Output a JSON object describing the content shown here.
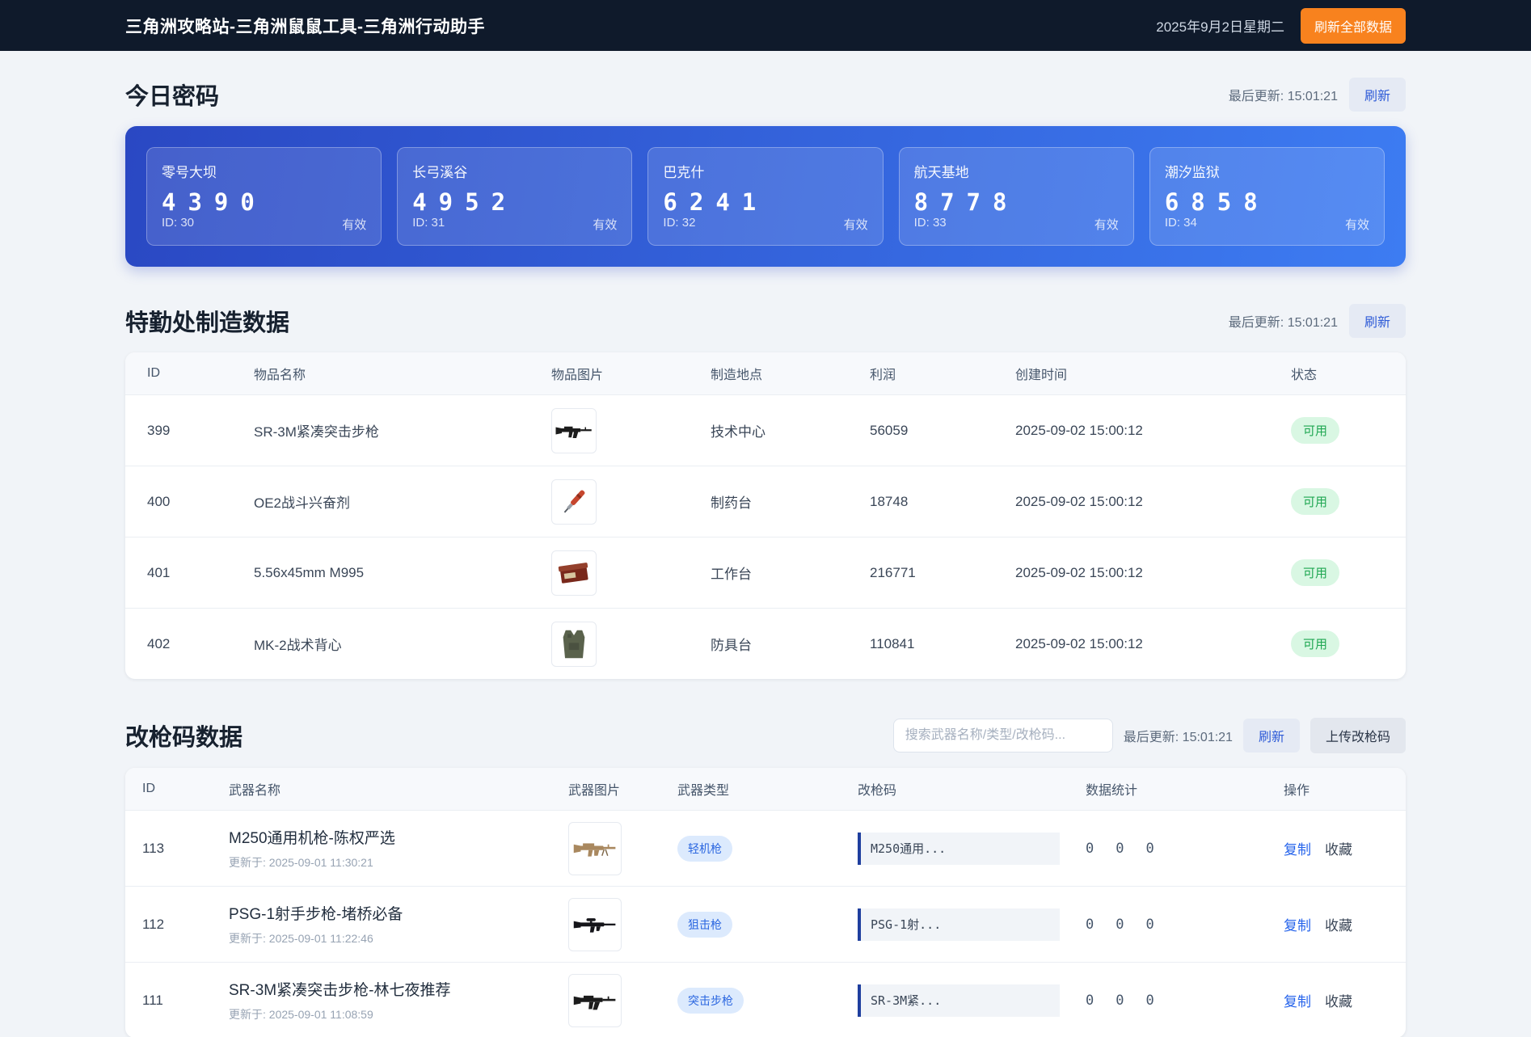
{
  "header": {
    "title": "三角洲攻略站-三角洲鼠鼠工具-三角洲行动助手",
    "date": "2025年9月2日星期二",
    "refresh_all_label": "刷新全部数据"
  },
  "passwords": {
    "title": "今日密码",
    "last_update": "最后更新: 15:01:21",
    "refresh_label": "刷新",
    "cards": [
      {
        "map": "零号大坝",
        "code": "4390",
        "id_label": "ID: 30",
        "status": "有效"
      },
      {
        "map": "长弓溪谷",
        "code": "4952",
        "id_label": "ID: 31",
        "status": "有效"
      },
      {
        "map": "巴克什",
        "code": "6241",
        "id_label": "ID: 32",
        "status": "有效"
      },
      {
        "map": "航天基地",
        "code": "8778",
        "id_label": "ID: 33",
        "status": "有效"
      },
      {
        "map": "潮汐监狱",
        "code": "6858",
        "id_label": "ID: 34",
        "status": "有效"
      }
    ]
  },
  "manufacture": {
    "title": "特勤处制造数据",
    "last_update": "最后更新: 15:01:21",
    "refresh_label": "刷新",
    "columns": [
      "ID",
      "物品名称",
      "物品图片",
      "制造地点",
      "利润",
      "创建时间",
      "状态"
    ],
    "rows": [
      {
        "id": "399",
        "name": "SR-3M紧凑突击步枪",
        "icon": "compact-rifle-icon",
        "location": "技术中心",
        "profit": "56059",
        "created": "2025-09-02 15:00:12",
        "status": "可用"
      },
      {
        "id": "400",
        "name": "OE2战斗兴奋剂",
        "icon": "injector-icon",
        "location": "制药台",
        "profit": "18748",
        "created": "2025-09-02 15:00:12",
        "status": "可用"
      },
      {
        "id": "401",
        "name": "5.56x45mm M995",
        "icon": "ammo-box-icon",
        "location": "工作台",
        "profit": "216771",
        "created": "2025-09-02 15:00:12",
        "status": "可用"
      },
      {
        "id": "402",
        "name": "MK-2战术背心",
        "icon": "vest-icon",
        "location": "防具台",
        "profit": "110841",
        "created": "2025-09-02 15:00:12",
        "status": "可用"
      }
    ]
  },
  "gun_codes": {
    "title": "改枪码数据",
    "search_placeholder": "搜索武器名称/类型/改枪码...",
    "last_update": "最后更新: 15:01:21",
    "refresh_label": "刷新",
    "upload_label": "上传改枪码",
    "columns": [
      "ID",
      "武器名称",
      "武器图片",
      "武器类型",
      "改枪码",
      "数据统计",
      "操作"
    ],
    "rows": [
      {
        "id": "113",
        "name": "M250通用机枪-陈权严选",
        "updated": "更新于: 2025-09-01 11:30:21",
        "icon": "machine-gun-icon",
        "type": "轻机枪",
        "code": "M250通用...",
        "stats": [
          "0",
          "0",
          "0"
        ],
        "copy": "复制",
        "favorite": "收藏"
      },
      {
        "id": "112",
        "name": "PSG-1射手步枪-堵桥必备",
        "updated": "更新于: 2025-09-01 11:22:46",
        "icon": "sniper-rifle-icon",
        "type": "狙击枪",
        "code": "PSG-1射...",
        "stats": [
          "0",
          "0",
          "0"
        ],
        "copy": "复制",
        "favorite": "收藏"
      },
      {
        "id": "111",
        "name": "SR-3M紧凑突击步枪-林七夜推荐",
        "updated": "更新于: 2025-09-01 11:08:59",
        "icon": "assault-rifle-icon",
        "type": "突击步枪",
        "code": "SR-3M紧...",
        "stats": [
          "0",
          "0",
          "0"
        ],
        "copy": "复制",
        "favorite": "收藏"
      }
    ]
  },
  "colors": {
    "accent_orange": "#f8821e",
    "panel_gradient_start": "#2a48c3",
    "panel_gradient_end": "#3d7cf2",
    "link_blue": "#2563eb",
    "status_green": "#1fa752",
    "header_dark": "#0f1a2b"
  }
}
